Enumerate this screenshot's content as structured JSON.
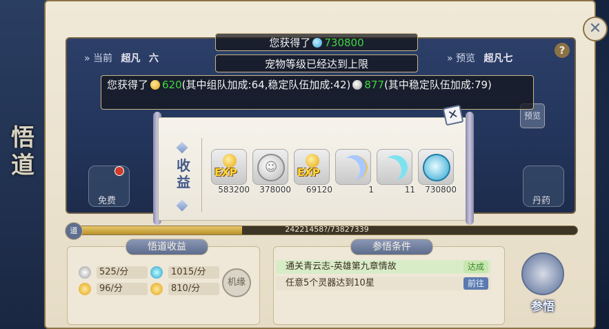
{
  "sidebar": {
    "title": "悟道"
  },
  "tiers": {
    "current_label": "当前",
    "current_name": "超凡",
    "current_level": "六",
    "preview_label": "预览",
    "preview_name": "超凡七"
  },
  "messages": {
    "msg1_prefix": "您获得了",
    "msg1_value": "730800",
    "msg2": "宠物等级已经达到上限",
    "msg3_prefix": "您获得了",
    "msg3_exp_value": "620",
    "msg3_exp_detail": "(其中组队加成:64,稳定队伍加成:42)",
    "msg3_silver_value": "877",
    "msg3_silver_detail": "(其中稳定队伍加成:79)"
  },
  "stage_buttons": {
    "free": "免费",
    "pill": "丹药",
    "preview": "预览"
  },
  "scroll": {
    "title": "收益",
    "rewards": [
      {
        "icon": "exp-orb-icon",
        "count": "583200"
      },
      {
        "icon": "silver-coin-icon",
        "count": "378000"
      },
      {
        "icon": "exp-orb-icon",
        "count": "69120"
      },
      {
        "icon": "gold-moon-icon",
        "count": "1"
      },
      {
        "icon": "blue-moon-icon",
        "count": "11"
      },
      {
        "icon": "blue-coin-icon",
        "count": "730800"
      }
    ]
  },
  "progress": {
    "cap_label": "道",
    "text": "24221458?/73827339",
    "fraction": 0.33
  },
  "income": {
    "title": "悟道收益",
    "items": [
      {
        "icon": "silver-coin-icon",
        "value": "525/分"
      },
      {
        "icon": "blue-coin-icon",
        "value": "1015/分"
      },
      {
        "icon": "exp-orb-icon",
        "value": "96/分"
      },
      {
        "icon": "exp-orb-icon",
        "value": "810/分"
      }
    ],
    "button": "机缘"
  },
  "conditions": {
    "title": "参悟条件",
    "items": [
      {
        "text": "通关青云志-英雄第九章情故",
        "status": "达成"
      },
      {
        "text": "任意5个灵器达到10星",
        "status": "前往"
      }
    ]
  },
  "action": {
    "label": "参悟"
  },
  "colors": {
    "gain_green": "#3fd83f",
    "panel_bg": "#efe8d8",
    "accent_blue": "#5a7ab0"
  }
}
